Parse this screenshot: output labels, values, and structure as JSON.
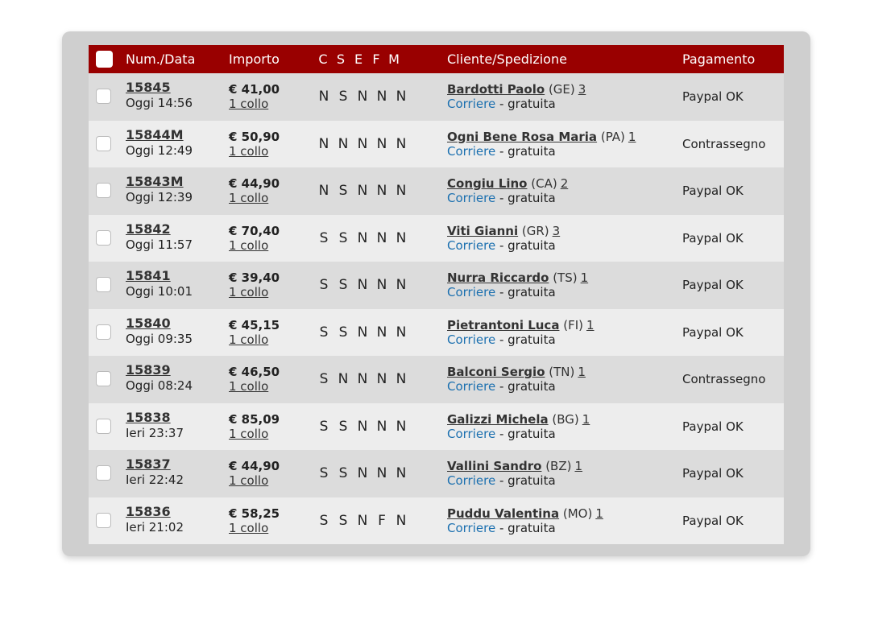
{
  "colors": {
    "header_bg": "#990000",
    "row_odd": "#dcdcdc",
    "row_even": "#ededed",
    "frame": "#cfcfcf",
    "carrier_link": "#1a6faf"
  },
  "header": {
    "num_date": "Num./Data",
    "importo": "Importo",
    "flags": [
      "C",
      "S",
      "E",
      "F",
      "M"
    ],
    "cliente": "Cliente/Spedizione",
    "pagamento": "Pagamento"
  },
  "rows": [
    {
      "num": "15845",
      "date": "Oggi 14:56",
      "amount": "€ 41,00",
      "colli": "1 collo",
      "flags": [
        "N",
        "S",
        "N",
        "N",
        "N"
      ],
      "client": "Bardotti Paolo",
      "prov": "(GE)",
      "count": "3",
      "carrier": "Corriere",
      "ship_note": " - gratuita",
      "payment": "Paypal OK"
    },
    {
      "num": "15844M",
      "date": "Oggi 12:49",
      "amount": "€ 50,90",
      "colli": "1 collo",
      "flags": [
        "N",
        "N",
        "N",
        "N",
        "N"
      ],
      "client": "Ogni Bene Rosa Maria",
      "prov": "(PA)",
      "count": "1",
      "carrier": "Corriere",
      "ship_note": " - gratuita",
      "payment": "Contrassegno"
    },
    {
      "num": "15843M",
      "date": "Oggi 12:39",
      "amount": "€ 44,90",
      "colli": "1 collo",
      "flags": [
        "N",
        "S",
        "N",
        "N",
        "N"
      ],
      "client": "Congiu Lino",
      "prov": "(CA)",
      "count": "2",
      "carrier": "Corriere",
      "ship_note": " - gratuita",
      "payment": "Paypal OK"
    },
    {
      "num": "15842",
      "date": "Oggi 11:57",
      "amount": "€ 70,40",
      "colli": "1 collo",
      "flags": [
        "S",
        "S",
        "N",
        "N",
        "N"
      ],
      "client": "Viti Gianni",
      "prov": "(GR)",
      "count": "3",
      "carrier": "Corriere",
      "ship_note": " - gratuita",
      "payment": "Paypal OK"
    },
    {
      "num": "15841",
      "date": "Oggi 10:01",
      "amount": "€ 39,40",
      "colli": "1 collo",
      "flags": [
        "S",
        "S",
        "N",
        "N",
        "N"
      ],
      "client": "Nurra Riccardo",
      "prov": "(TS)",
      "count": "1",
      "carrier": "Corriere",
      "ship_note": " - gratuita",
      "payment": "Paypal OK"
    },
    {
      "num": "15840",
      "date": "Oggi 09:35",
      "amount": "€ 45,15",
      "colli": "1 collo",
      "flags": [
        "S",
        "S",
        "N",
        "N",
        "N"
      ],
      "client": "Pietrantoni Luca",
      "prov": "(FI)",
      "count": "1",
      "carrier": "Corriere",
      "ship_note": " - gratuita",
      "payment": "Paypal OK"
    },
    {
      "num": "15839",
      "date": "Oggi 08:24",
      "amount": "€ 46,50",
      "colli": "1 collo",
      "flags": [
        "S",
        "N",
        "N",
        "N",
        "N"
      ],
      "client": "Balconi Sergio",
      "prov": "(TN)",
      "count": "1",
      "carrier": "Corriere",
      "ship_note": " - gratuita",
      "payment": "Contrassegno"
    },
    {
      "num": "15838",
      "date": "Ieri 23:37",
      "amount": "€ 85,09",
      "colli": "1 collo",
      "flags": [
        "S",
        "S",
        "N",
        "N",
        "N"
      ],
      "client": "Galizzi Michela",
      "prov": "(BG)",
      "count": "1",
      "carrier": "Corriere",
      "ship_note": " - gratuita",
      "payment": "Paypal OK"
    },
    {
      "num": "15837",
      "date": "Ieri 22:42",
      "amount": "€ 44,90",
      "colli": "1 collo",
      "flags": [
        "S",
        "S",
        "N",
        "N",
        "N"
      ],
      "client": "Vallini Sandro",
      "prov": "(BZ)",
      "count": "1",
      "carrier": "Corriere",
      "ship_note": " - gratuita",
      "payment": "Paypal OK"
    },
    {
      "num": "15836",
      "date": "Ieri 21:02",
      "amount": "€ 58,25",
      "colli": "1 collo",
      "flags": [
        "S",
        "S",
        "N",
        "F",
        "N"
      ],
      "client": "Puddu Valentina",
      "prov": "(MO)",
      "count": "1",
      "carrier": "Corriere",
      "ship_note": " - gratuita",
      "payment": "Paypal OK"
    }
  ]
}
